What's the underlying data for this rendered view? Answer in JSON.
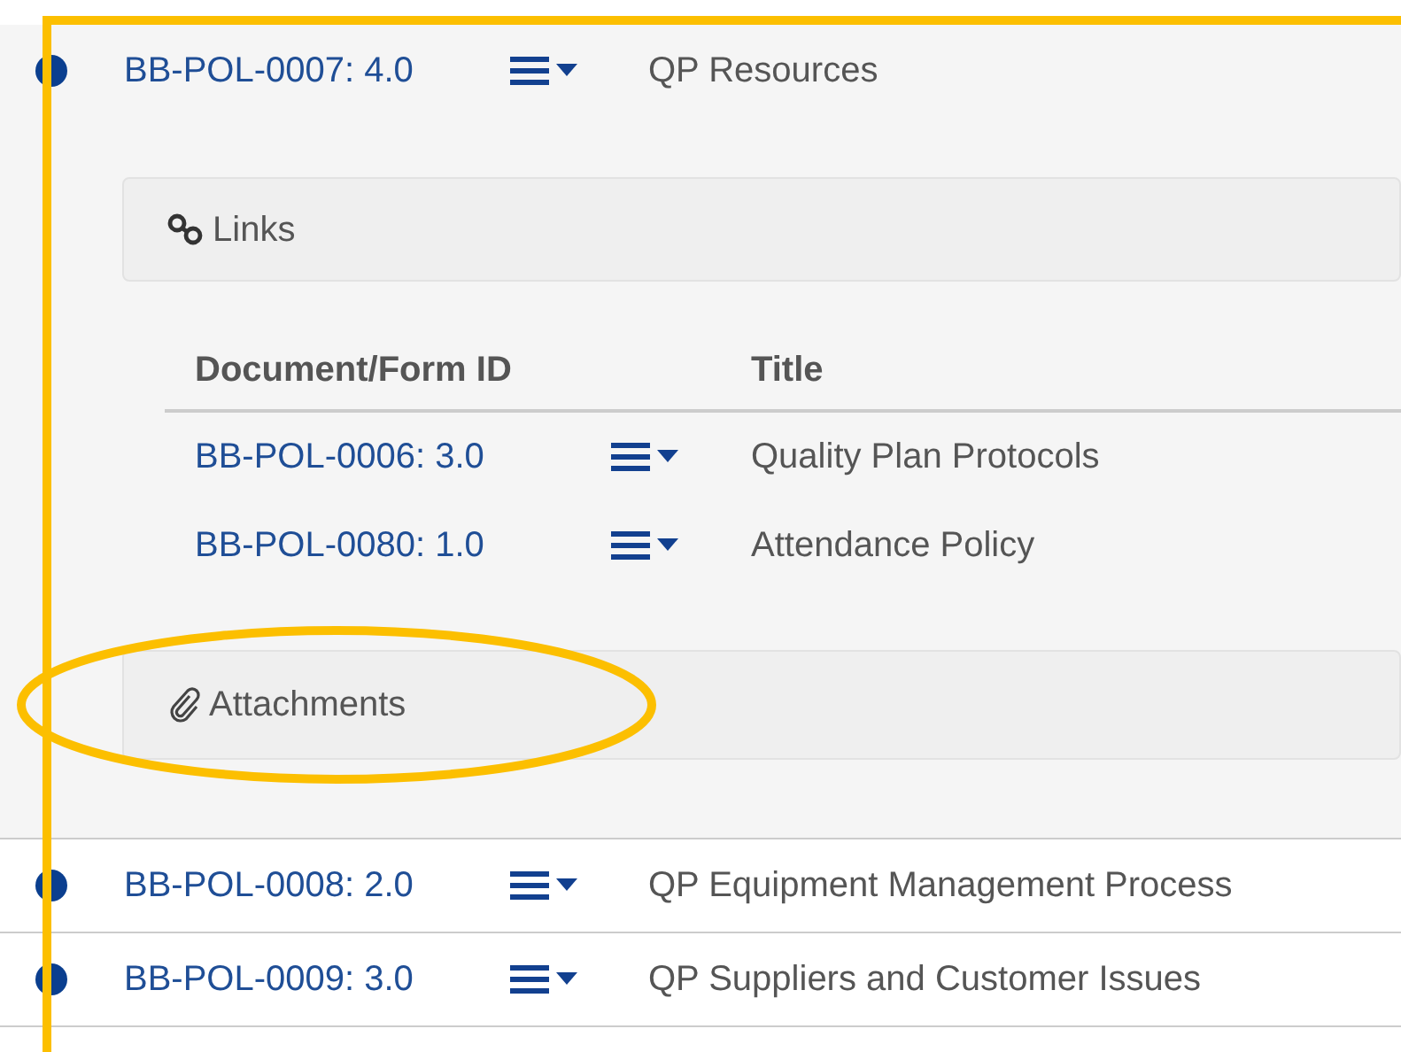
{
  "highlight_frame": true,
  "documents": [
    {
      "id": "BB-POL-0007: 4.0",
      "title": "QP Resources",
      "expanded": true,
      "links": {
        "heading": "Links",
        "columns": [
          "Document/Form ID",
          "Title"
        ],
        "rows": [
          {
            "id": "BB-POL-0006: 3.0",
            "title": "Quality Plan Protocols"
          },
          {
            "id": "BB-POL-0080: 1.0",
            "title": "Attendance Policy"
          }
        ]
      },
      "attachments": {
        "heading": "Attachments",
        "highlighted": true
      }
    },
    {
      "id": "BB-POL-0008: 2.0",
      "title": "QP Equipment Management Process",
      "expanded": false
    },
    {
      "id": "BB-POL-0009: 3.0",
      "title": "QP Suppliers and Customer Issues",
      "expanded": false
    }
  ]
}
